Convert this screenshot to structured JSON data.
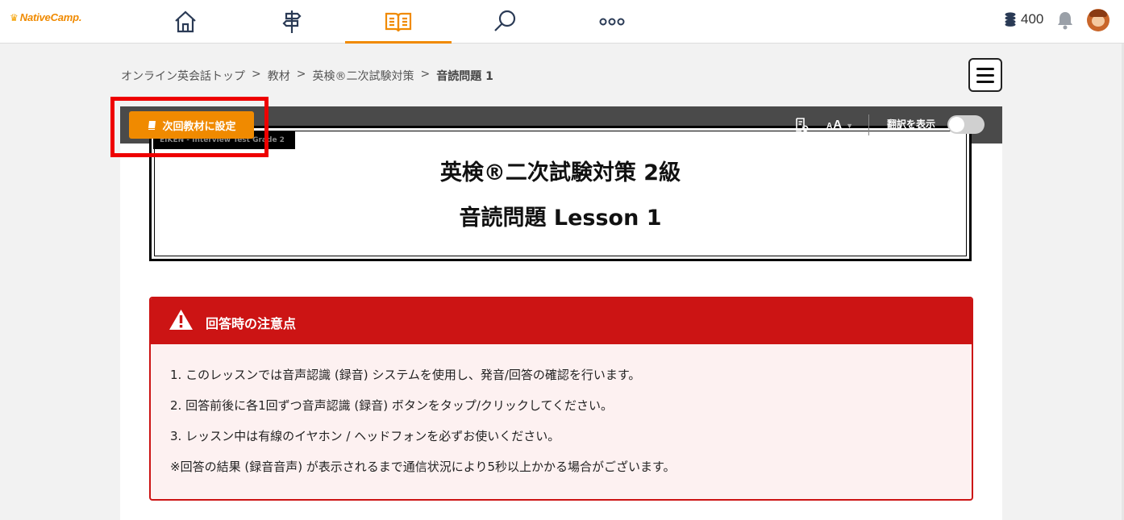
{
  "header": {
    "logo_text": "NativeCamp.",
    "nav": [
      {
        "name": "home"
      },
      {
        "name": "signpost"
      },
      {
        "name": "book",
        "active": true
      },
      {
        "name": "search"
      },
      {
        "name": "more"
      }
    ],
    "coins": "400"
  },
  "breadcrumb": {
    "items": [
      "オンライン英会話トップ",
      "教材",
      "英検®二次試験対策"
    ],
    "current": "音読問題 1",
    "separator": ">"
  },
  "toolbar": {
    "next_button": "次回教材に設定",
    "font_small": "A",
    "font_large": "A",
    "translate_label": "翻訳を表示",
    "translate_on": false
  },
  "lesson": {
    "badge": "EIKEN - Interview Test Grade 2",
    "title": "英検®二次試験対策 2級",
    "subtitle": "音読問題 Lesson 1"
  },
  "notice": {
    "title": "回答時の注意点",
    "items": [
      "1. このレッスンでは音声認識 (録音) システムを使用し、発音/回答の確認を行います。",
      "2. 回答前後に各1回ずつ音声認識 (録音) ボタンをタップ/クリックしてください。",
      "3. レッスン中は有線のイヤホン / ヘッドフォンを必ずお使いください。",
      "※回答の結果 (録音音声) が表示されるまで通信状況により5秒以上かかる場合がございます。"
    ]
  },
  "colors": {
    "accent": "#f08a00",
    "notice_red": "#cc1414",
    "highlight_red": "#ee0000"
  }
}
